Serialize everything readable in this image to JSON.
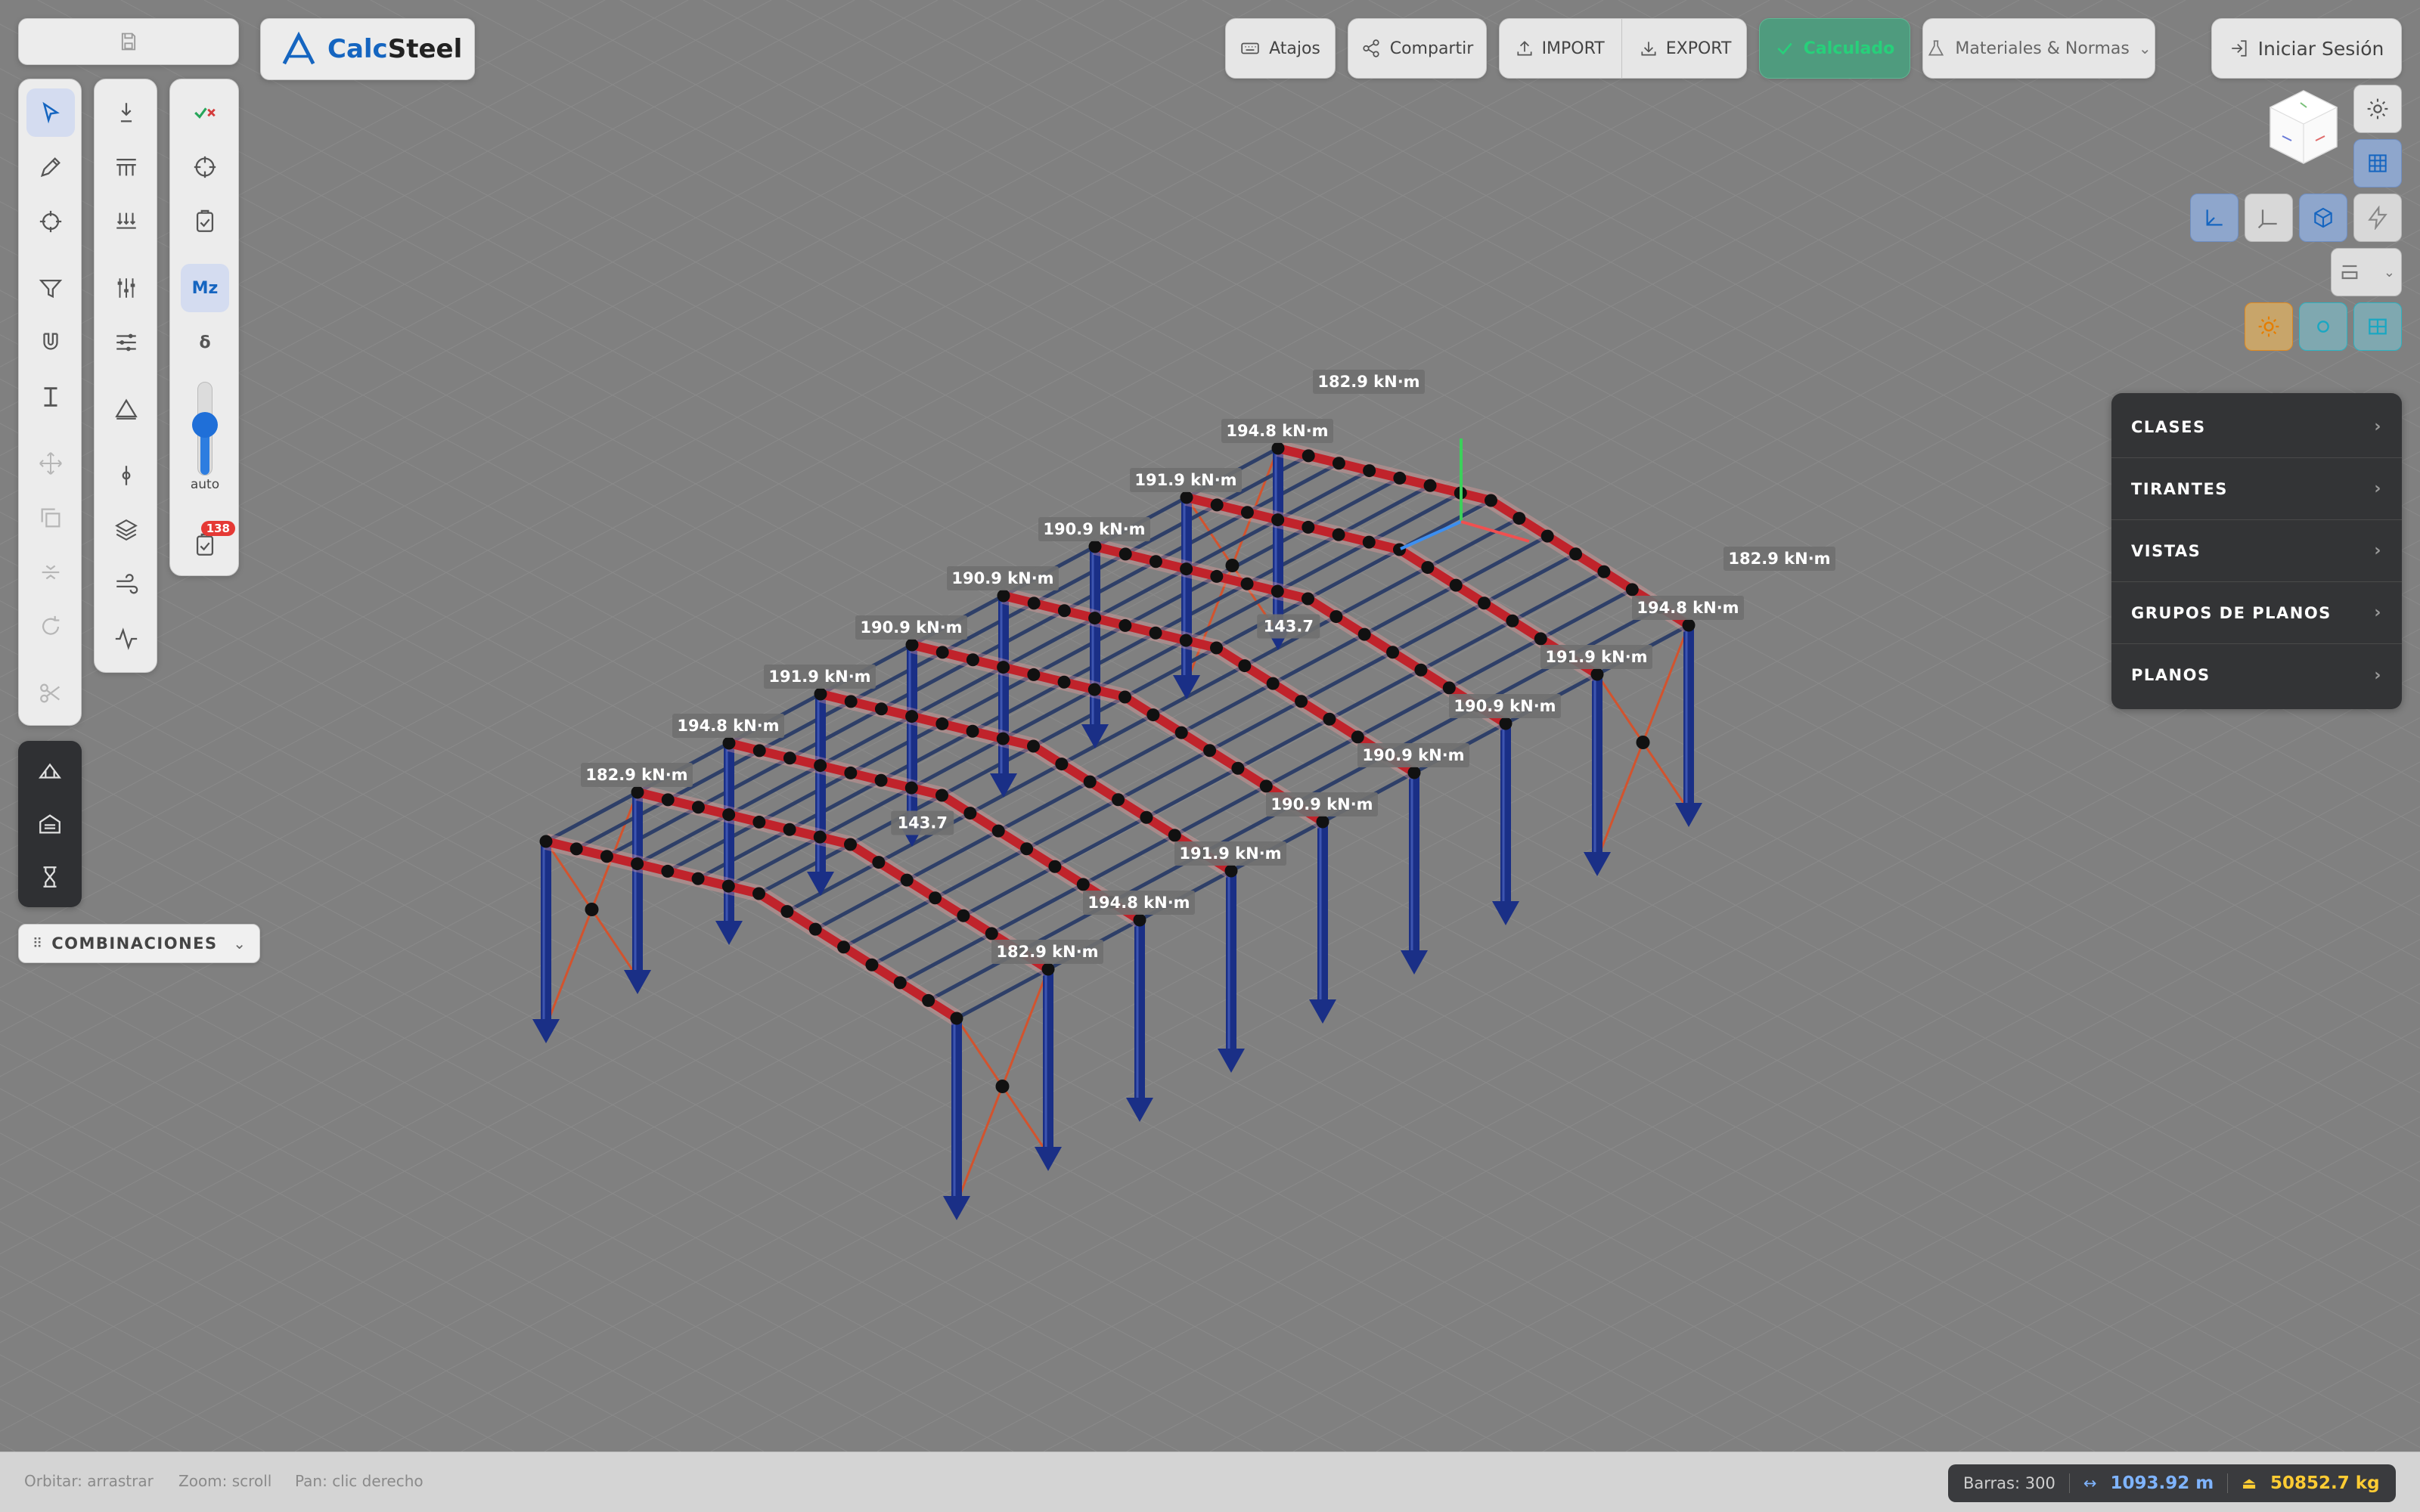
{
  "app": {
    "brand_calc": "Calc",
    "brand_steel": "Steel"
  },
  "toolbar_top": {
    "atajos": "Atajos",
    "compartir": "Compartir",
    "import": "IMPORT",
    "export": "EXPORT",
    "calculado": "Calculado",
    "materiales": "Materiales & Normas",
    "login": "Iniciar Sesión"
  },
  "left_tools": {
    "mz_label": "Mz",
    "delta_label": "δ",
    "slider_label": "auto",
    "slider_level": 0.55,
    "check_badge": "138",
    "combinations": "COMBINACIONES"
  },
  "side_menu": {
    "items": [
      {
        "label": "CLASES"
      },
      {
        "label": "TIRANTES"
      },
      {
        "label": "VISTAS"
      },
      {
        "label": "GRUPOS DE PLANOS"
      },
      {
        "label": "PLANOS"
      }
    ]
  },
  "structure": {
    "frames": 9,
    "moment_labels": [
      {
        "frame": 0,
        "side": "L",
        "text": "182.9 kN·m"
      },
      {
        "frame": 1,
        "side": "L",
        "text": "194.8 kN·m"
      },
      {
        "frame": 2,
        "side": "L",
        "text": "191.9 kN·m"
      },
      {
        "frame": 3,
        "side": "L",
        "text": "190.9 kN·m"
      },
      {
        "frame": 4,
        "side": "L",
        "text": "190.9 kN·m"
      },
      {
        "frame": 5,
        "side": "L",
        "text": "190.9 kN·m"
      },
      {
        "frame": 6,
        "side": "L",
        "text": "191.9 kN·m"
      },
      {
        "frame": 7,
        "side": "L",
        "text": "194.8 kN·m"
      },
      {
        "frame": 8,
        "side": "L",
        "text": "182.9 kN·m"
      },
      {
        "frame": 0,
        "side": "R",
        "text": "182.9 kN·m"
      },
      {
        "frame": 1,
        "side": "R",
        "text": "194.8 kN·m"
      },
      {
        "frame": 2,
        "side": "R",
        "text": "191.9 kN·m"
      },
      {
        "frame": 3,
        "side": "R",
        "text": "190.9 kN·m"
      },
      {
        "frame": 4,
        "side": "R",
        "text": "190.9 kN·m"
      },
      {
        "frame": 5,
        "side": "R",
        "text": "190.9 kN·m"
      },
      {
        "frame": 6,
        "side": "R",
        "text": "191.9 kN·m"
      },
      {
        "frame": 7,
        "side": "R",
        "text": "194.8 kN·m"
      },
      {
        "frame": 8,
        "side": "R",
        "text": "182.9 kN·m"
      }
    ],
    "partial_labels": [
      "143.7",
      "143.7"
    ],
    "colors": {
      "column": "#1a2f86",
      "rafter": "#c0232b",
      "purlin": "#2e3f68",
      "brace": "#d2532e",
      "node": "#111111"
    }
  },
  "status": {
    "hint_orbit": "Orbitar: arrastrar",
    "hint_zoom": "Zoom: scroll",
    "hint_pan": "Pan: clic derecho",
    "bars": "Barras: 300",
    "length": "1093.92 m",
    "weight": "50852.7 kg"
  },
  "colors": {
    "accent": "#1565c0",
    "calc_green": "#27c07a",
    "length_blue": "#7fb4ff",
    "weight_yellow": "#ffcc33",
    "badge_red": "#e53935"
  }
}
